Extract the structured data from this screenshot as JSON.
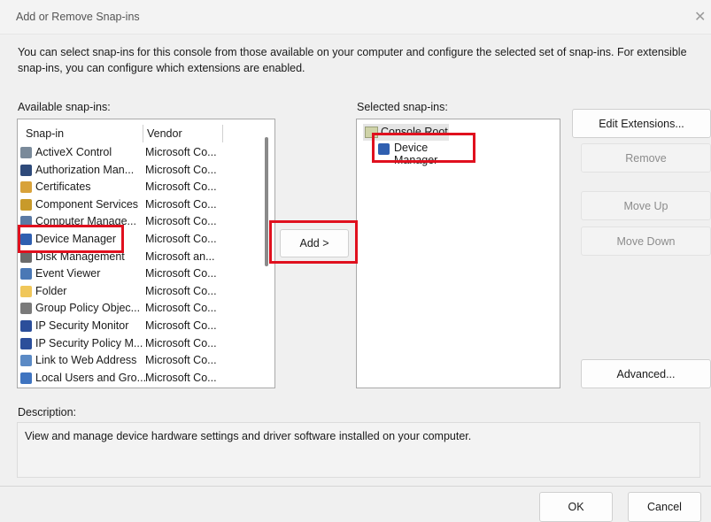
{
  "window": {
    "title": "Add or Remove Snap-ins",
    "close_glyph": "✕"
  },
  "intro_text": "You can select snap-ins for this console from those available on your computer and configure the selected set of snap-ins. For extensible snap-ins, you can configure which extensions are enabled.",
  "available": {
    "label": "Available snap-ins:",
    "col_snapin": "Snap-in",
    "col_vendor": "Vendor",
    "items": [
      {
        "name": "ActiveX Control",
        "vendor": "Microsoft Co...",
        "icon": "activex-icon",
        "color": "#7a8a9a"
      },
      {
        "name": "Authorization Man...",
        "vendor": "Microsoft Co...",
        "icon": "authorization-icon",
        "color": "#2e4a7a"
      },
      {
        "name": "Certificates",
        "vendor": "Microsoft Co...",
        "icon": "certificates-icon",
        "color": "#d8a23a"
      },
      {
        "name": "Component Services",
        "vendor": "Microsoft Co...",
        "icon": "component-services-icon",
        "color": "#c89a2a"
      },
      {
        "name": "Computer Manage...",
        "vendor": "Microsoft Co...",
        "icon": "computer-management-icon",
        "color": "#5b7aa5"
      },
      {
        "name": "Device Manager",
        "vendor": "Microsoft Co...",
        "icon": "device-manager-icon",
        "color": "#2f5fb0"
      },
      {
        "name": "Disk Management",
        "vendor": "Microsoft an...",
        "icon": "disk-management-icon",
        "color": "#6b6b6b"
      },
      {
        "name": "Event Viewer",
        "vendor": "Microsoft Co...",
        "icon": "event-viewer-icon",
        "color": "#4a78b5"
      },
      {
        "name": "Folder",
        "vendor": "Microsoft Co...",
        "icon": "folder-icon",
        "color": "#f0c75a"
      },
      {
        "name": "Group Policy Objec...",
        "vendor": "Microsoft Co...",
        "icon": "group-policy-icon",
        "color": "#7a7a7a"
      },
      {
        "name": "IP Security Monitor",
        "vendor": "Microsoft Co...",
        "icon": "ip-security-monitor-icon",
        "color": "#2b4e9a"
      },
      {
        "name": "IP Security Policy M...",
        "vendor": "Microsoft Co...",
        "icon": "ip-security-policy-icon",
        "color": "#2b4e9a"
      },
      {
        "name": "Link to Web Address",
        "vendor": "Microsoft Co...",
        "icon": "link-web-address-icon",
        "color": "#5b8ac5"
      },
      {
        "name": "Local Users and Gro...",
        "vendor": "Microsoft Co...",
        "icon": "local-users-icon",
        "color": "#3f74c0"
      }
    ]
  },
  "add_button": "Add >",
  "selected": {
    "label": "Selected snap-ins:",
    "root": "Console Root",
    "child": "Device Manager"
  },
  "buttons": {
    "edit_extensions": "Edit Extensions...",
    "remove": "Remove",
    "move_up": "Move Up",
    "move_down": "Move Down",
    "advanced": "Advanced...",
    "ok": "OK",
    "cancel": "Cancel"
  },
  "description": {
    "label": "Description:",
    "text": "View and manage device hardware settings and driver software installed on your computer."
  },
  "colors": {
    "highlight": "#e0101e",
    "dialog_bg": "#f0f0f0"
  }
}
